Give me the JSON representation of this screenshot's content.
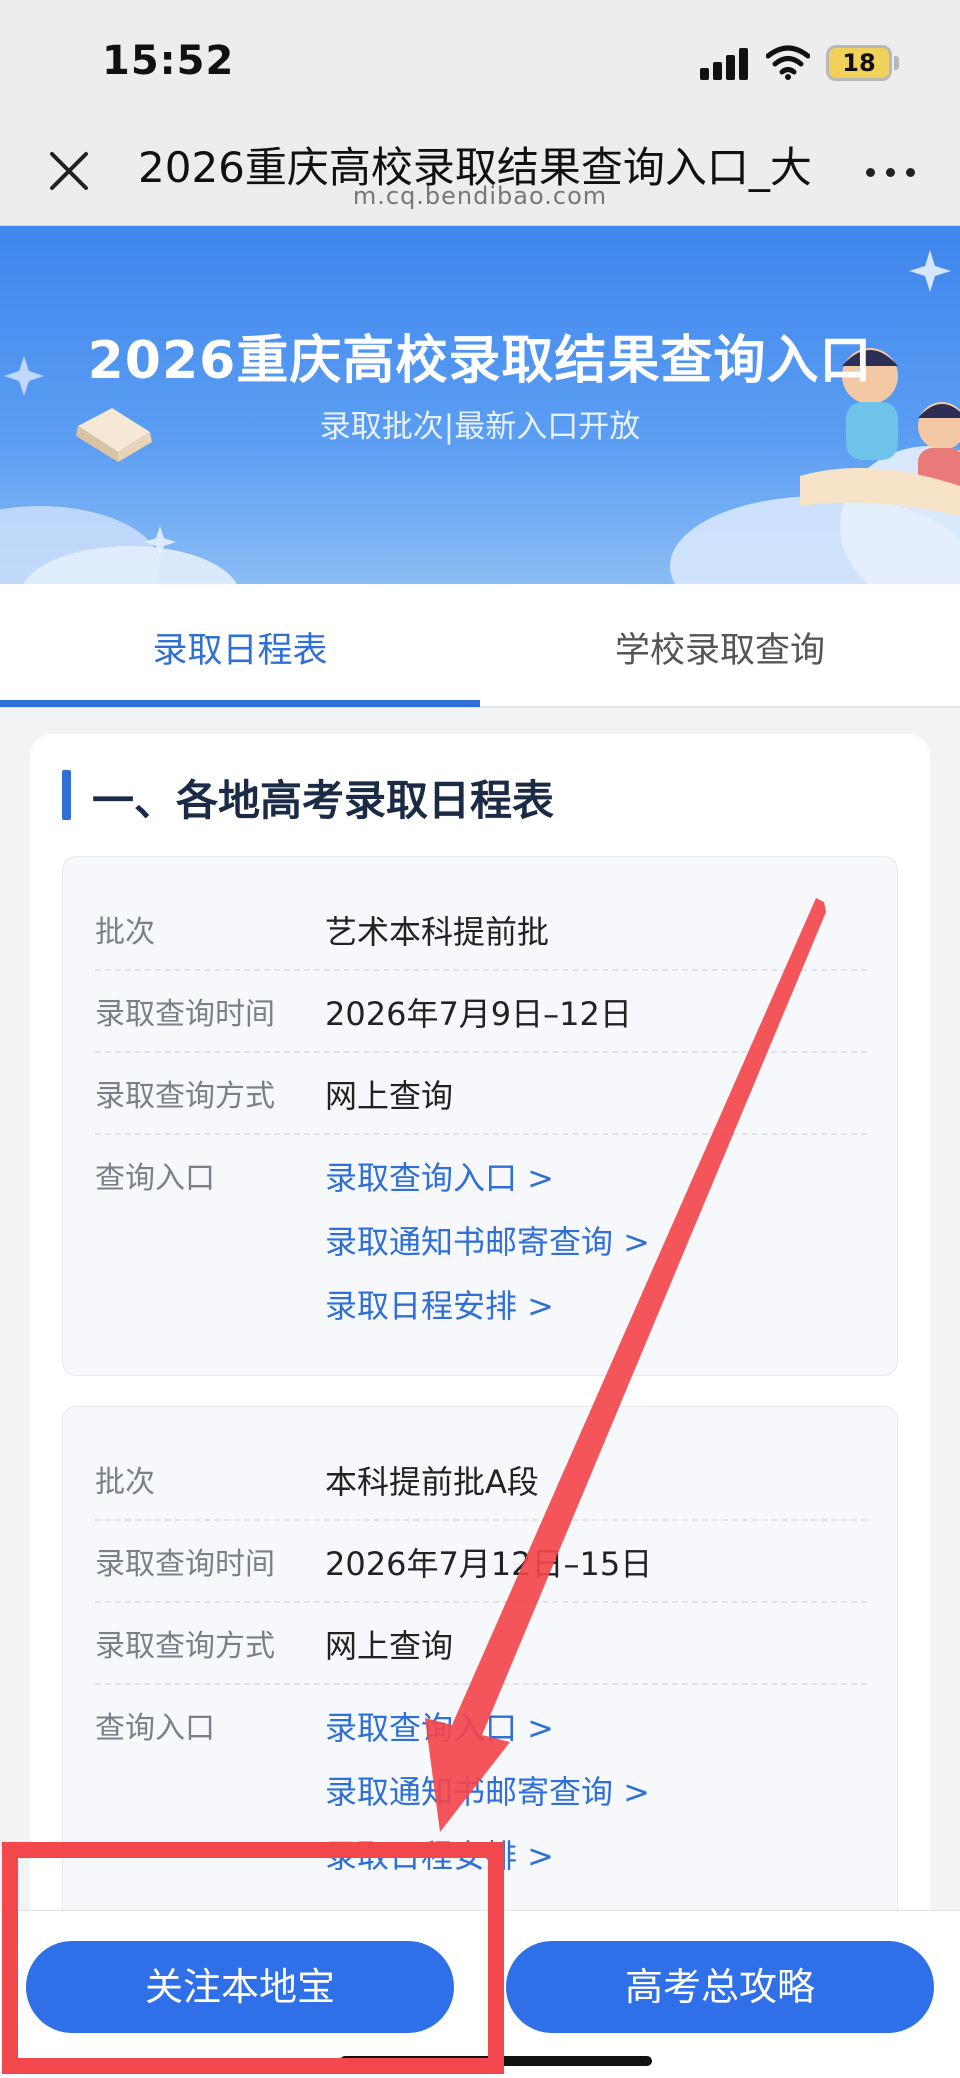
{
  "status_bar": {
    "time": "15:52",
    "battery": "18"
  },
  "browser": {
    "title": "2026重庆高校录取结果查询入口_大",
    "url": "m.cq.bendibao.com"
  },
  "banner": {
    "title": "2026重庆高校录取结果查询入口",
    "subtitle": "录取批次|最新入口开放"
  },
  "tabs": [
    {
      "label": "录取日程表",
      "active": true
    },
    {
      "label": "学校录取查询",
      "active": false
    }
  ],
  "section": {
    "title": "一、各地高考录取日程表"
  },
  "labels": {
    "batch": "批次",
    "time": "录取查询时间",
    "method": "录取查询方式",
    "entry": "查询入口"
  },
  "schedule": [
    {
      "batch": "艺术本科提前批",
      "time": "2026年7月9日–12日",
      "method": "网上查询",
      "links": [
        "录取查询入口 >",
        "录取通知书邮寄查询 >",
        "录取日程安排 >"
      ]
    },
    {
      "batch": "本科提前批A段",
      "time": "2026年7月12日–15日",
      "method": "网上查询",
      "links": [
        "录取查询入口 >",
        "录取通知书邮寄查询 >",
        "录取日程安排 >"
      ]
    }
  ],
  "bottom": {
    "follow_button": "关注本地宝",
    "guide_button": "高考总攻略"
  },
  "colors": {
    "accent": "#2f6fd6",
    "annotation": "#f2474c"
  }
}
